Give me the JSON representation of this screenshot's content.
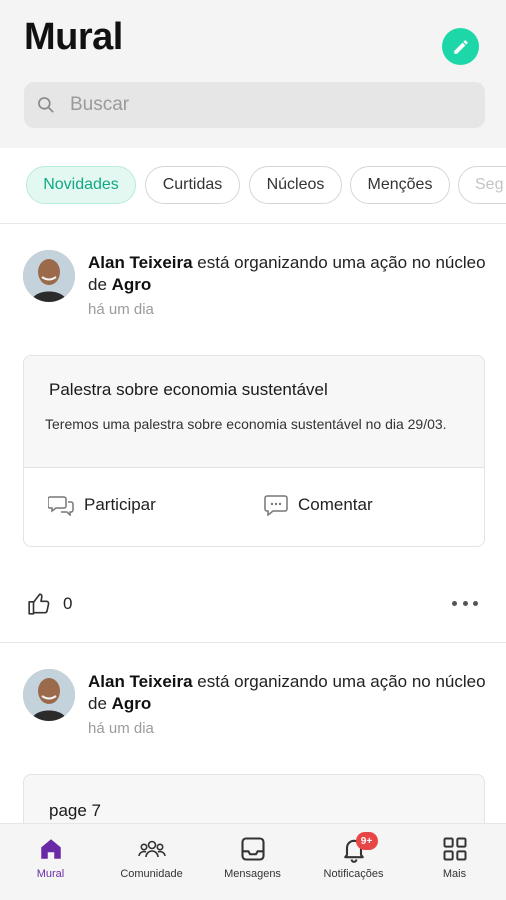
{
  "header": {
    "title": "Mural",
    "search_placeholder": "Buscar"
  },
  "filters": [
    "Novidades",
    "Curtidas",
    "Núcleos",
    "Menções",
    "Seg"
  ],
  "posts": [
    {
      "author": "Alan Teixeira",
      "action": " está organizando uma ação no núcleo de ",
      "group": "Agro",
      "time": "há um dia",
      "card": {
        "title": "Palestra sobre economia sustentável",
        "description": "Teremos uma palestra sobre economia sustentável no dia 29/03.",
        "participate_label": "Participar",
        "comment_label": "Comentar"
      },
      "likes": "0"
    },
    {
      "author": "Alan Teixeira",
      "action": " está organizando uma ação no núcleo de ",
      "group": "Agro",
      "time": "há um dia",
      "card": {
        "title": "page 7"
      }
    }
  ],
  "tabbar": [
    {
      "label": "Mural",
      "icon": "home-icon"
    },
    {
      "label": "Comunidade",
      "icon": "community-icon"
    },
    {
      "label": "Mensagens",
      "icon": "inbox-icon"
    },
    {
      "label": "Notificações",
      "icon": "bell-icon",
      "badge": "9+"
    },
    {
      "label": "Mais",
      "icon": "grid-icon"
    }
  ],
  "colors": {
    "accent": "#1ed7a8",
    "active_tab": "#6a2aa8",
    "badge": "#e84646"
  }
}
